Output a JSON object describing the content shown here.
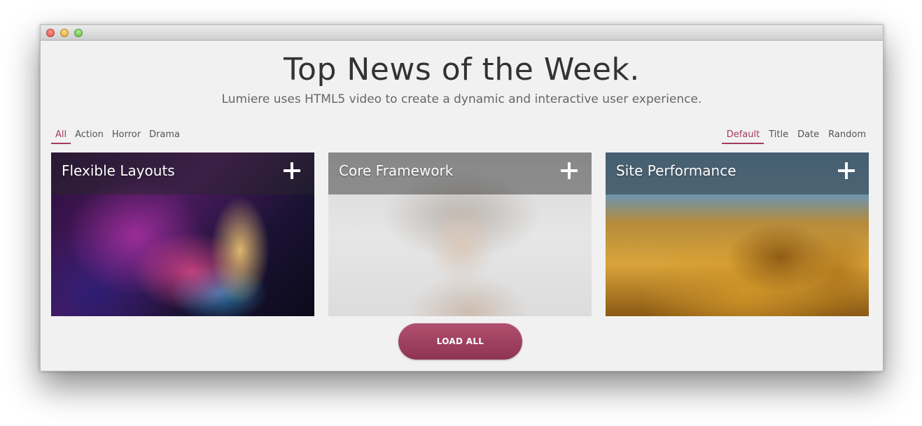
{
  "header": {
    "title": "Top News of the Week.",
    "subtitle": "Lumiere uses HTML5 video to create a dynamic and interactive user experience."
  },
  "filters": {
    "items": [
      "All",
      "Action",
      "Horror",
      "Drama"
    ],
    "active": "All"
  },
  "sort": {
    "items": [
      "Default",
      "Title",
      "Date",
      "Random"
    ],
    "active": "Default"
  },
  "cards": [
    {
      "title": "Flexible Layouts",
      "icon": "plus-icon"
    },
    {
      "title": "Core Framework",
      "icon": "plus-icon"
    },
    {
      "title": "Site Performance",
      "icon": "plus-icon"
    }
  ],
  "load_button": {
    "label": "LOAD ALL"
  },
  "colors": {
    "accent": "#a63a5c",
    "button": "#9d3f5f",
    "background": "#f1f1f1"
  }
}
